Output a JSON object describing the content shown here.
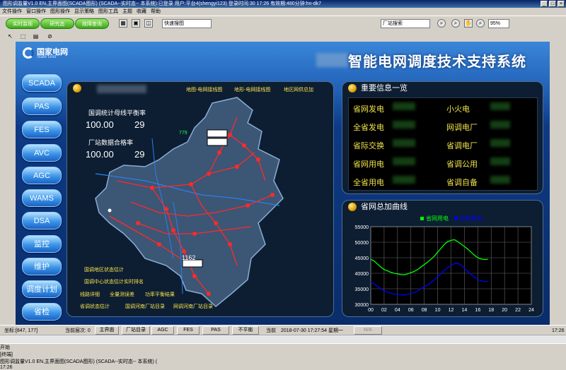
{
  "window": {
    "title": "图形调监量V1.0 EN,主界面图(SCADA图形) (SCADA--实时态-- 本系统):已登录   用户:平台4(shengyi123)  登录时间:30 17:26  有效期:480分钟:hn-dk7"
  },
  "menu": {
    "items": [
      "文件操作",
      "窗口操作",
      "图形操作",
      "显示策略",
      "图形工具",
      "主题",
      "收藏",
      "帮助"
    ]
  },
  "toolbar": {
    "buttons": [
      "实时监视",
      "研究态",
      "故障查询"
    ],
    "search_value": "快速搜图",
    "station_search_value": "厂站搜索",
    "zoom_value": "95%"
  },
  "header": {
    "logo_cn": "国家电网",
    "logo_en": "State Grid",
    "system_title": "智能电网调度技术支持系统"
  },
  "nav": {
    "items": [
      "SCADA",
      "PAS",
      "FES",
      "AVC",
      "AGC",
      "WAMS",
      "DSA",
      "监控",
      "维护",
      "调度计划",
      "省检"
    ]
  },
  "map_panel": {
    "links": [
      "地图-电网接线图",
      "地形-电网接线图",
      "地区网供总加"
    ],
    "stat1_label": "国调统计母线平衡率",
    "stat1_value": "100.00",
    "stat1_count": "29",
    "stat2_label": "厂站数据合格率",
    "stat2_value": "100.00",
    "stat2_count": "29",
    "map_numbers": [
      "779",
      "1162"
    ],
    "bottom_links": [
      "国调地区状态估计",
      "国调中心状态估计实时排名",
      "线路详细",
      "全量测误差",
      "功率平衡结果",
      "省调状态估计",
      "国调河南厂站目录",
      "网调河南厂站目录"
    ]
  },
  "info_panel": {
    "title": "重要信息一览",
    "items": [
      "省网发电",
      "小火电",
      "全省发电",
      "网调电厂",
      "省际交换",
      "省调电厂",
      "省网用电",
      "省调公用",
      "全省用电",
      "省调自备"
    ]
  },
  "chart_panel": {
    "title": "省网总加曲线"
  },
  "chart_data": {
    "type": "line",
    "title": "省网总加曲线",
    "xlabel": "",
    "ylabel": "",
    "x_ticks": [
      "00",
      "02",
      "04",
      "06",
      "08",
      "10",
      "12",
      "14",
      "16",
      "18",
      "20",
      "22",
      "24"
    ],
    "y_ticks": [
      30000,
      35000,
      40000,
      45000,
      50000,
      55000
    ],
    "xlim": [
      0,
      24
    ],
    "ylim": [
      30000,
      55000
    ],
    "grid": true,
    "legend_position": "top",
    "series": [
      {
        "name": "省网用电",
        "color": "#00ff00",
        "x": [
          0,
          0.5,
          1,
          1.5,
          2,
          2.5,
          3,
          3.5,
          4,
          4.5,
          5,
          5.5,
          6,
          6.5,
          7,
          7.5,
          8,
          8.5,
          9,
          9.5,
          10,
          10.5,
          11,
          11.5,
          12,
          12.5,
          13,
          13.5,
          14,
          14.5,
          15,
          15.5,
          16,
          16.5,
          17,
          17.5
        ],
        "y": [
          44500,
          44000,
          43000,
          42000,
          41200,
          40800,
          40300,
          40000,
          39800,
          39600,
          39500,
          39800,
          40200,
          40600,
          41200,
          42000,
          42800,
          43600,
          44500,
          45500,
          46800,
          48000,
          49300,
          50200,
          50600,
          50800,
          50200,
          49400,
          48600,
          47800,
          46800,
          45800,
          45000,
          44600,
          44400,
          44500
        ]
      },
      {
        "name": "省网发电",
        "color": "#0000ff",
        "x": [
          0,
          0.5,
          1,
          1.5,
          2,
          2.5,
          3,
          3.5,
          4,
          4.5,
          5,
          5.5,
          6,
          6.5,
          7,
          7.5,
          8,
          8.5,
          9,
          9.5,
          10,
          10.5,
          11,
          11.5,
          12,
          12.5,
          13,
          13.5,
          14,
          14.5,
          15,
          15.5,
          16,
          16.5,
          17,
          17.5
        ],
        "y": [
          37200,
          36600,
          35800,
          35000,
          34400,
          33900,
          33600,
          33300,
          33200,
          33100,
          33000,
          33200,
          33500,
          33800,
          34300,
          35000,
          35600,
          36200,
          37000,
          37800,
          38800,
          39800,
          41000,
          41800,
          42400,
          43100,
          43300,
          42600,
          41600,
          40600,
          39600,
          38700,
          38000,
          37600,
          37300,
          37400
        ]
      }
    ]
  },
  "statusbar": {
    "coord": "坐标:[847, 177]",
    "layer": "当前层次: 0",
    "buttons": [
      "主界面",
      "厂站目录",
      "AGC",
      "FES",
      "PAS",
      "不平衡"
    ],
    "current_label": "当前",
    "datetime": "2018-07-30 17:27:54 星期一",
    "na": "N/A",
    "clock": "17:26"
  },
  "taskbar": {
    "start": "开始",
    "task": "[终端]",
    "window": "图形调监量V1.0 EN,主界面图(SCADA图形) (SCADA--实时态-- 本系统) (",
    "clock": "17:26"
  }
}
